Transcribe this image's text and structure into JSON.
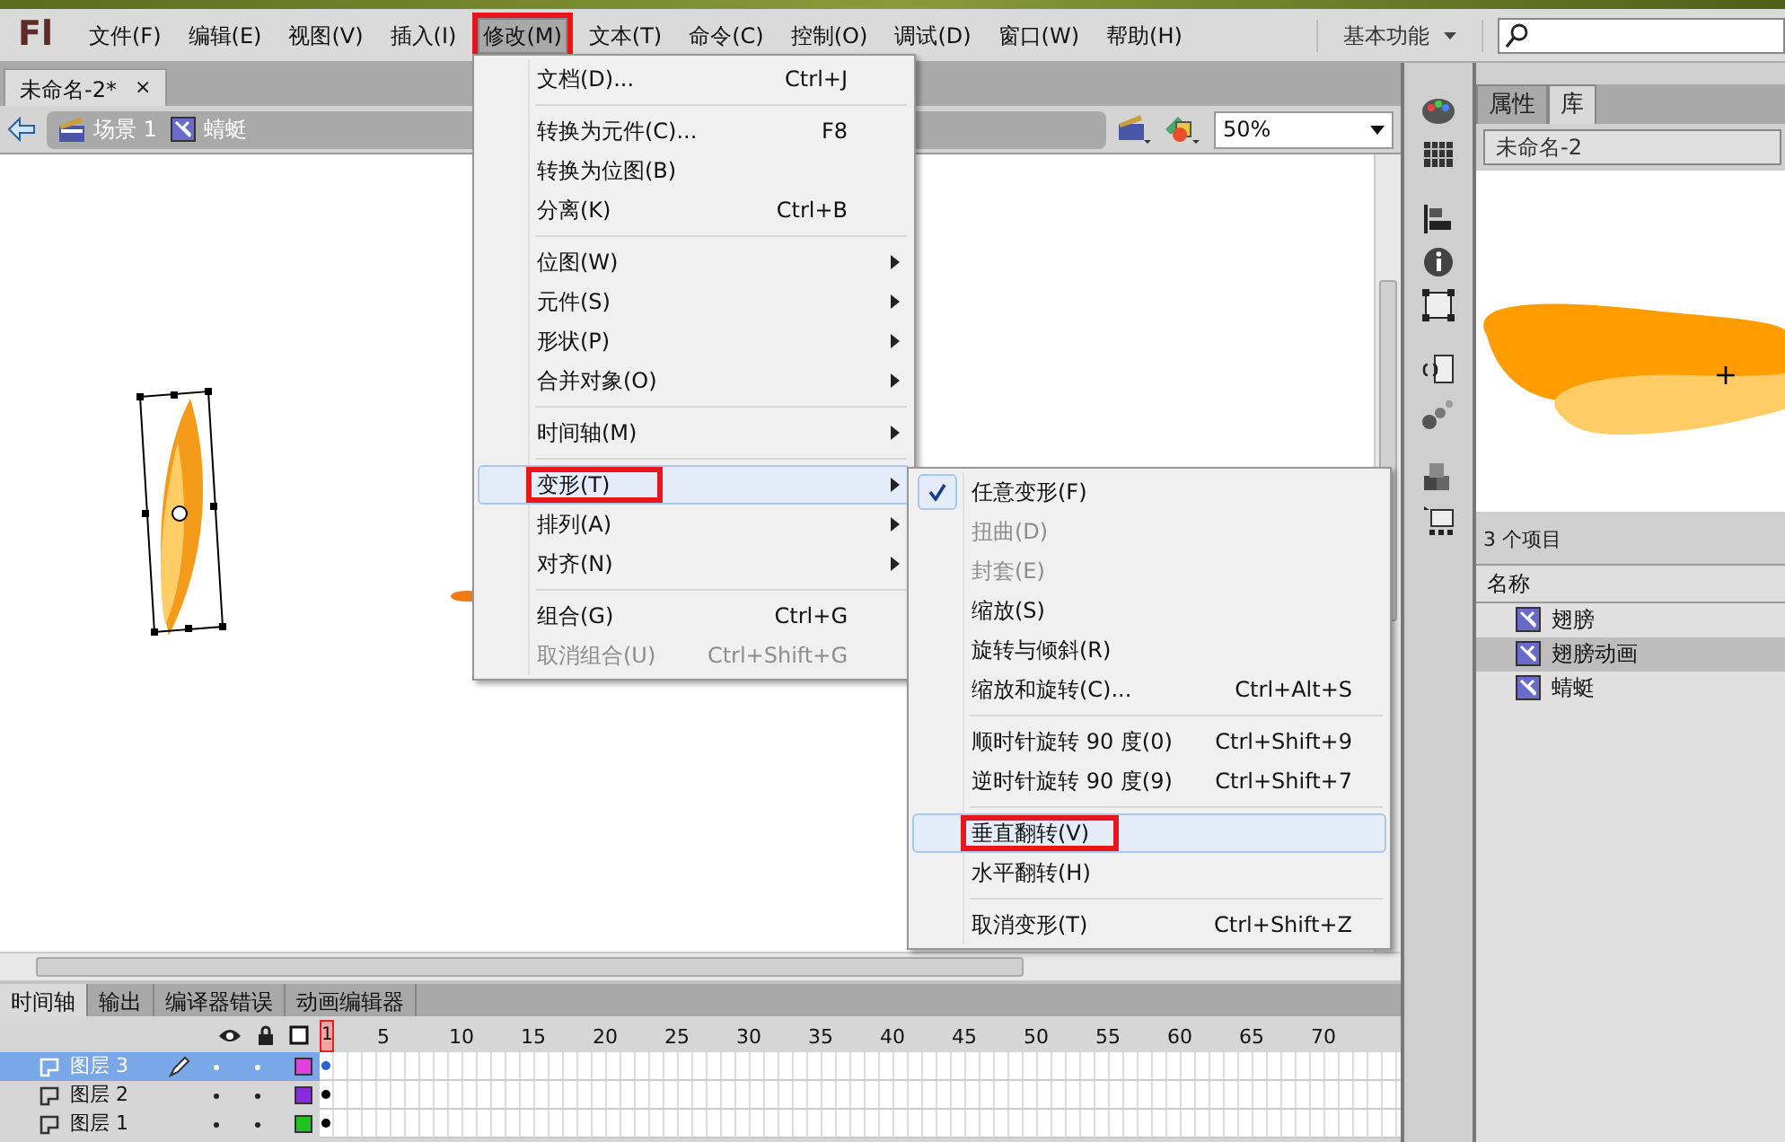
{
  "app_logo": "Fl",
  "menubar": [
    {
      "label": "文件(F)",
      "selected": false,
      "highlighted": false
    },
    {
      "label": "编辑(E)",
      "selected": false,
      "highlighted": false
    },
    {
      "label": "视图(V)",
      "selected": false,
      "highlighted": false
    },
    {
      "label": "插入(I)",
      "selected": false,
      "highlighted": false
    },
    {
      "label": "修改(M)",
      "selected": true,
      "highlighted": true
    },
    {
      "label": "文本(T)",
      "selected": false,
      "highlighted": false
    },
    {
      "label": "命令(C)",
      "selected": false,
      "highlighted": false
    },
    {
      "label": "控制(O)",
      "selected": false,
      "highlighted": false
    },
    {
      "label": "调试(D)",
      "selected": false,
      "highlighted": false
    },
    {
      "label": "窗口(W)",
      "selected": false,
      "highlighted": false
    },
    {
      "label": "帮助(H)",
      "selected": false,
      "highlighted": false
    }
  ],
  "workspace": "基本功能",
  "document_tabs": [
    {
      "label": "未命名-2*",
      "close": "×",
      "selected": true
    }
  ],
  "breadcrumb": [
    {
      "label": "场景 1",
      "kind": "scene"
    },
    {
      "label": "蜻蜓",
      "kind": "symbol"
    }
  ],
  "zoom": "50%",
  "modify_menu": [
    {
      "kind": "item",
      "label": "文档(D)...",
      "shortcut": "Ctrl+J",
      "has_submenu": false,
      "disabled": false,
      "selected": false,
      "highlighted": false
    },
    {
      "kind": "separator"
    },
    {
      "kind": "item",
      "label": "转换为元件(C)...",
      "shortcut": "F8",
      "has_submenu": false,
      "disabled": false,
      "selected": false,
      "highlighted": false
    },
    {
      "kind": "item",
      "label": "转换为位图(B)",
      "has_submenu": false,
      "disabled": false,
      "selected": false,
      "highlighted": false
    },
    {
      "kind": "item",
      "label": "分离(K)",
      "shortcut": "Ctrl+B",
      "has_submenu": false,
      "disabled": false,
      "selected": false,
      "highlighted": false
    },
    {
      "kind": "separator"
    },
    {
      "kind": "item",
      "label": "位图(W)",
      "has_submenu": true,
      "disabled": false,
      "selected": false,
      "highlighted": false
    },
    {
      "kind": "item",
      "label": "元件(S)",
      "has_submenu": true,
      "disabled": false,
      "selected": false,
      "highlighted": false
    },
    {
      "kind": "item",
      "label": "形状(P)",
      "has_submenu": true,
      "disabled": false,
      "selected": false,
      "highlighted": false
    },
    {
      "kind": "item",
      "label": "合并对象(O)",
      "has_submenu": true,
      "disabled": false,
      "selected": false,
      "highlighted": false
    },
    {
      "kind": "separator"
    },
    {
      "kind": "item",
      "label": "时间轴(M)",
      "has_submenu": true,
      "disabled": false,
      "selected": false,
      "highlighted": false
    },
    {
      "kind": "separator"
    },
    {
      "kind": "item",
      "label": "变形(T)",
      "has_submenu": true,
      "disabled": false,
      "selected": true,
      "highlighted": true
    },
    {
      "kind": "item",
      "label": "排列(A)",
      "has_submenu": true,
      "disabled": false,
      "selected": false,
      "highlighted": false
    },
    {
      "kind": "item",
      "label": "对齐(N)",
      "has_submenu": true,
      "disabled": false,
      "selected": false,
      "highlighted": false
    },
    {
      "kind": "separator"
    },
    {
      "kind": "item",
      "label": "组合(G)",
      "shortcut": "Ctrl+G",
      "has_submenu": false,
      "disabled": false,
      "selected": false,
      "highlighted": false
    },
    {
      "kind": "item",
      "label": "取消组合(U)",
      "shortcut": "Ctrl+Shift+G",
      "has_submenu": false,
      "disabled": true,
      "selected": false,
      "highlighted": false
    }
  ],
  "transform_menu": [
    {
      "kind": "item",
      "label": "任意变形(F)",
      "checked": true,
      "disabled": false,
      "selected": false,
      "highlighted": false
    },
    {
      "kind": "item",
      "label": "扭曲(D)",
      "checked": false,
      "disabled": true,
      "selected": false,
      "highlighted": false
    },
    {
      "kind": "item",
      "label": "封套(E)",
      "checked": false,
      "disabled": true,
      "selected": false,
      "highlighted": false
    },
    {
      "kind": "item",
      "label": "缩放(S)",
      "checked": false,
      "disabled": false,
      "selected": false,
      "highlighted": false
    },
    {
      "kind": "item",
      "label": "旋转与倾斜(R)",
      "checked": false,
      "disabled": false,
      "selected": false,
      "highlighted": false
    },
    {
      "kind": "item",
      "label": "缩放和旋转(C)...",
      "shortcut": "Ctrl+Alt+S",
      "checked": false,
      "disabled": false,
      "selected": false,
      "highlighted": false
    },
    {
      "kind": "separator"
    },
    {
      "kind": "item",
      "label": "顺时针旋转 90 度(0)",
      "shortcut": "Ctrl+Shift+9",
      "checked": false,
      "disabled": false,
      "selected": false,
      "highlighted": false
    },
    {
      "kind": "item",
      "label": "逆时针旋转 90 度(9)",
      "shortcut": "Ctrl+Shift+7",
      "checked": false,
      "disabled": false,
      "selected": false,
      "highlighted": false
    },
    {
      "kind": "separator"
    },
    {
      "kind": "item",
      "label": "垂直翻转(V)",
      "checked": false,
      "disabled": false,
      "selected": true,
      "highlighted": true
    },
    {
      "kind": "item",
      "label": "水平翻转(H)",
      "checked": false,
      "disabled": false,
      "selected": false,
      "highlighted": false
    },
    {
      "kind": "separator"
    },
    {
      "kind": "item",
      "label": "取消变形(T)",
      "shortcut": "Ctrl+Shift+Z",
      "checked": false,
      "disabled": false,
      "selected": false,
      "highlighted": false
    }
  ],
  "panel_tabs": [
    {
      "label": "属性",
      "selected": false
    },
    {
      "label": "库",
      "selected": true
    }
  ],
  "library": {
    "document": "未命名-2",
    "item_count": "3 个项目",
    "column": "名称",
    "items": [
      {
        "label": "翅膀",
        "selected": false
      },
      {
        "label": "翅膀动画",
        "selected": true
      },
      {
        "label": "蜻蜓",
        "selected": false
      }
    ]
  },
  "timeline": {
    "tabs": [
      {
        "label": "时间轴",
        "selected": true
      },
      {
        "label": "输出",
        "selected": false
      },
      {
        "label": "编译器错误",
        "selected": false
      },
      {
        "label": "动画编辑器",
        "selected": false
      }
    ],
    "current_frame": "1",
    "frame_numbers": [
      "5",
      "10",
      "15",
      "20",
      "25",
      "30",
      "35",
      "40",
      "45",
      "50",
      "55",
      "60",
      "65",
      "70"
    ],
    "layers": [
      {
        "name": "图层 3",
        "selected": true,
        "color": "#e040e0"
      },
      {
        "name": "图层 2",
        "selected": false,
        "color": "#8a2be2"
      },
      {
        "name": "图层 1",
        "selected": false,
        "color": "#22c022"
      }
    ]
  }
}
